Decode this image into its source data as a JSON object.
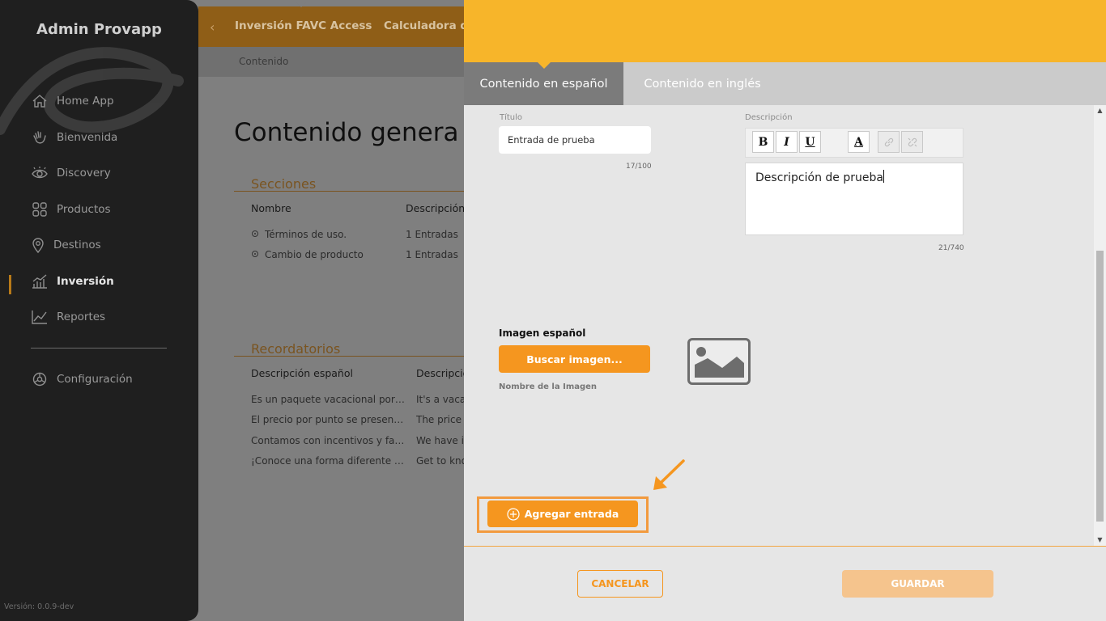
{
  "sidebar": {
    "app_title": "Admin Provapp",
    "items": [
      {
        "label": "Home App",
        "icon": "home-icon"
      },
      {
        "label": "Bienvenida",
        "icon": "wave-hand-icon"
      },
      {
        "label": "Discovery",
        "icon": "eye-icon"
      },
      {
        "label": "Productos",
        "icon": "grid-icon"
      },
      {
        "label": "Destinos",
        "icon": "location-pin-icon"
      },
      {
        "label": "Inversión",
        "icon": "investment-chart-icon"
      },
      {
        "label": "Reportes",
        "icon": "line-chart-icon"
      },
      {
        "label": "Configuración",
        "icon": "gear-icon"
      }
    ],
    "active_item": "Inversión",
    "version": "Versión: 0.0.9-dev"
  },
  "background": {
    "tabs": [
      "Inversión FAVC Access",
      "Calculadora d"
    ],
    "breadcrumb": "Contenido",
    "page_title": "Contenido genera",
    "sections": {
      "title": "Secciones",
      "headers": [
        "Nombre",
        "Descripción"
      ],
      "rows": [
        {
          "name": "Términos de uso.",
          "desc": "1 Entradas"
        },
        {
          "name": "Cambio de producto",
          "desc": "1 Entradas"
        }
      ]
    },
    "reminders": {
      "title": "Recordatorios",
      "headers": [
        "Descripción español",
        "Descripció"
      ],
      "rows": [
        {
          "es": "Es un paquete vacacional por…",
          "en": "It's a vaca"
        },
        {
          "es": "El precio por punto se presen…",
          "en": "The price p"
        },
        {
          "es": "Contamos con incentivos y fa…",
          "en": "We have in"
        },
        {
          "es": "¡Conoce una forma diferente …",
          "en": "Get to kno"
        }
      ]
    }
  },
  "drawer": {
    "tabs": {
      "spanish": "Contenido en español",
      "english": "Contenido en inglés"
    },
    "title_field": {
      "label": "Título",
      "value": "Entrada de prueba",
      "counter": "17/100"
    },
    "description_field": {
      "label": "Descripción",
      "toolbar": {
        "bold": "B",
        "italic": "I",
        "underline": "U",
        "color": "A"
      },
      "value": "Descripción de prueba",
      "counter": "21/740"
    },
    "image": {
      "label": "Imagen español",
      "button": "Buscar imagen...",
      "name_label": "Nombre de la Imagen"
    },
    "add_entry": "Agregar entrada",
    "cancel": "CANCELAR",
    "save": "GUARDAR"
  },
  "colors": {
    "accent": "#f7b52a",
    "button": "#f5961f",
    "highlight": "#f29a3e",
    "sidebar_bg": "#1f1f1f"
  }
}
